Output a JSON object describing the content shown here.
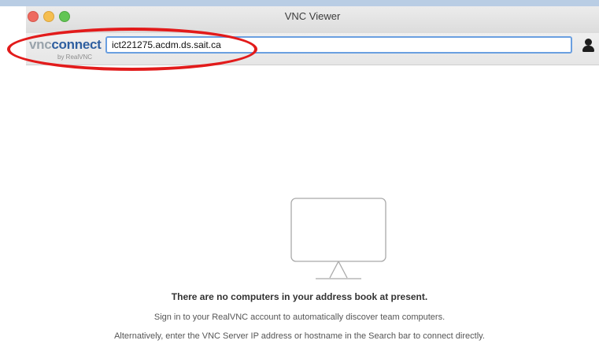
{
  "window": {
    "title": "VNC Viewer"
  },
  "toolbar": {
    "logo": {
      "part1": "vnc",
      "part2": "connect",
      "subtitle": "by RealVNC"
    },
    "search": {
      "value": "ict221275.acdm.ds.sait.ca"
    },
    "account_icon": "user-icon"
  },
  "empty_state": {
    "icon": "monitor-icon",
    "heading": "There are no computers in your address book at present.",
    "line1": "Sign in to your RealVNC account to automatically discover team computers.",
    "line2": "Alternatively, enter the VNC Server IP address or hostname in the Search bar to connect directly."
  },
  "colors": {
    "annotation": "#e21b1b",
    "search_focus": "#6a9fe0",
    "brand_blue": "#2f5fa0"
  }
}
